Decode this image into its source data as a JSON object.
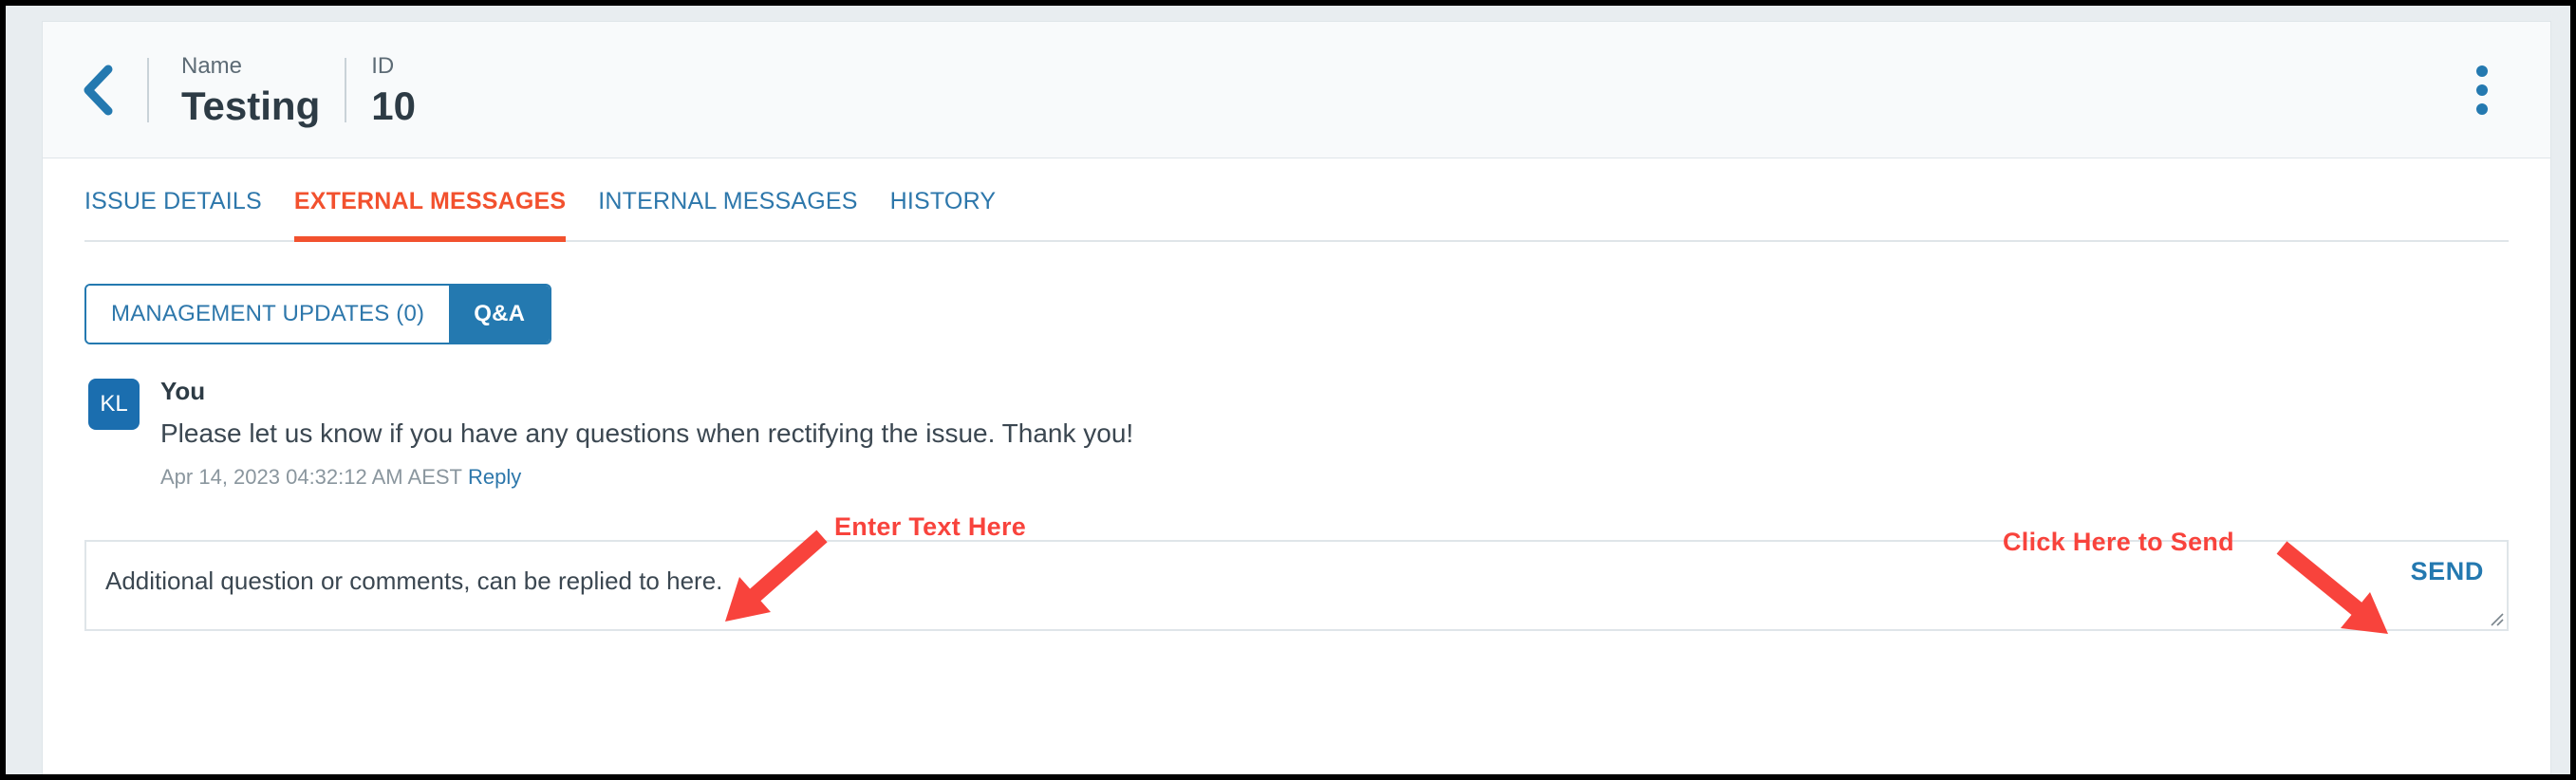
{
  "header": {
    "back_icon": "chevron-left-icon",
    "name_label": "Name",
    "name_value": "Testing",
    "id_label": "ID",
    "id_value": "10",
    "menu_icon": "kebab-menu-icon"
  },
  "tabs": [
    {
      "label": "ISSUE DETAILS",
      "active": false
    },
    {
      "label": "EXTERNAL MESSAGES",
      "active": true
    },
    {
      "label": "INTERNAL MESSAGES",
      "active": false
    },
    {
      "label": "HISTORY",
      "active": false
    }
  ],
  "segmented": {
    "management_updates": "MANAGEMENT UPDATES (0)",
    "qa": "Q&A"
  },
  "message": {
    "avatar_initials": "KL",
    "author": "You",
    "text": "Please let us know if you have any questions when rectifying the issue. Thank you!",
    "timestamp": "Apr 14, 2023 04:32:12 AM AEST",
    "reply_label": "Reply"
  },
  "composer": {
    "value": "Additional question or comments, can be replied to here.",
    "placeholder": "Additional question or comments, can be replied to here.",
    "send_label": "SEND",
    "resize_icon": "resize-grip-icon"
  },
  "annotations": [
    {
      "text": "Enter Text Here",
      "arrow": "arrow-down-left-icon"
    },
    {
      "text": "Click Here to Send",
      "arrow": "arrow-down-right-icon"
    }
  ],
  "colors": {
    "accent_blue": "#2479b0",
    "active_tab_orange": "#f2512e",
    "annotation_red": "#f8433c",
    "header_bg": "#f8fafb",
    "border": "#dfe5e9"
  }
}
